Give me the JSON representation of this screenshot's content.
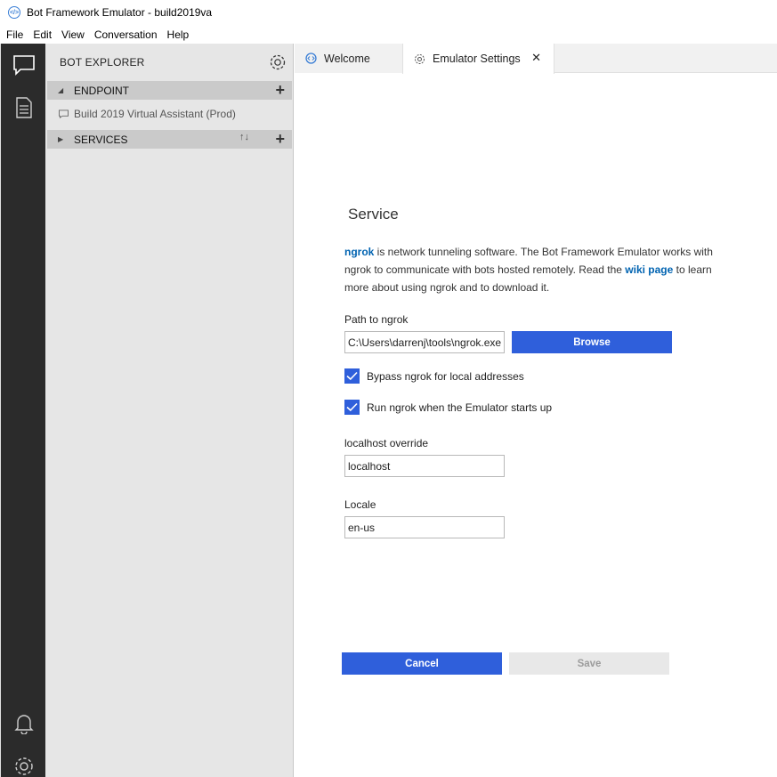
{
  "window": {
    "title": "Bot Framework Emulator - build2019va"
  },
  "menu": [
    "File",
    "Edit",
    "View",
    "Conversation",
    "Help"
  ],
  "activity_bar": {
    "icons": [
      "chat-icon",
      "document-icon",
      "bell-icon",
      "gear-icon"
    ]
  },
  "explorer": {
    "title": "BOT EXPLORER",
    "endpoint_label": "ENDPOINT",
    "endpoint_item": "Build 2019 Virtual Assistant (Prod)",
    "services_label": "SERVICES"
  },
  "tabs": [
    {
      "label": "Welcome"
    },
    {
      "label": "Emulator Settings"
    }
  ],
  "settings": {
    "heading": "Service",
    "desc_link1": "ngrok",
    "desc_part1": " is network tunneling software. The Bot Framework Emulator works with ngrok to communicate with bots hosted remotely. Read the ",
    "desc_link2": "wiki page",
    "desc_part2": " to learn more about using ngrok and to download it.",
    "path_label": "Path to ngrok",
    "path_value": "C:\\Users\\darrenj\\tools\\ngrok.exe",
    "browse_label": "Browse",
    "bypass_label": "Bypass ngrok for local addresses",
    "bypass_checked": true,
    "run_label": "Run ngrok when the Emulator starts up",
    "run_checked": true,
    "localhost_label": "localhost override",
    "localhost_value": "localhost",
    "locale_label": "Locale",
    "locale_value": "en-us",
    "cancel_label": "Cancel",
    "save_label": "Save"
  },
  "colors": {
    "accent": "#2f5fdb",
    "link": "#0063b1",
    "activity_bg": "#2b2b2b",
    "explorer_bg": "#e6e6e6"
  }
}
